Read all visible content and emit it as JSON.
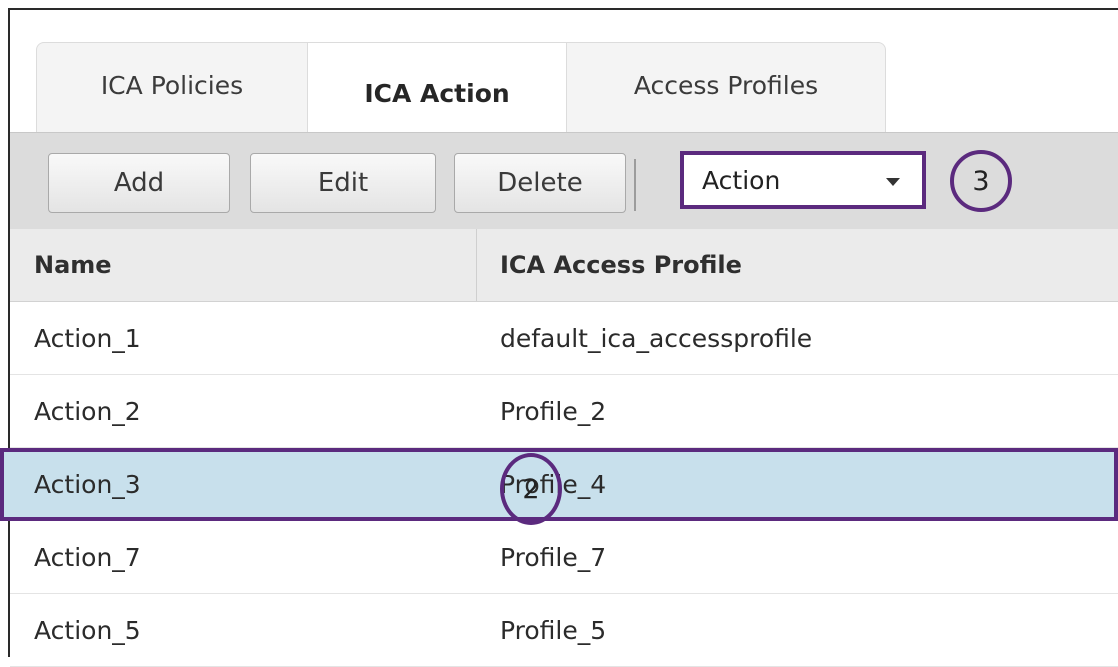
{
  "tabs": [
    {
      "label": "ICA Policies",
      "active": false
    },
    {
      "label": "ICA Action",
      "active": true
    },
    {
      "label": "Access Profiles",
      "active": false
    }
  ],
  "toolbar": {
    "add_label": "Add",
    "edit_label": "Edit",
    "delete_label": "Delete",
    "select_value": "Action",
    "callout_label": "3"
  },
  "table": {
    "columns": [
      "Name",
      "ICA Access Profile"
    ],
    "rows": [
      {
        "name": "Action_1",
        "profile": "default_ica_accessprofile"
      },
      {
        "name": "Action_2",
        "profile": "Profile_2"
      },
      {
        "name": "Action_3",
        "profile": "Profile_4",
        "selected": true,
        "callout": "2"
      },
      {
        "name": "Action_7",
        "profile": "Profile_7"
      },
      {
        "name": "Action_5",
        "profile": "Profile_5"
      }
    ]
  },
  "colors": {
    "callout_border": "#5b2a7e",
    "selected_row": "#c8e0ec",
    "toolbar_bg": "#dcdcdc"
  }
}
